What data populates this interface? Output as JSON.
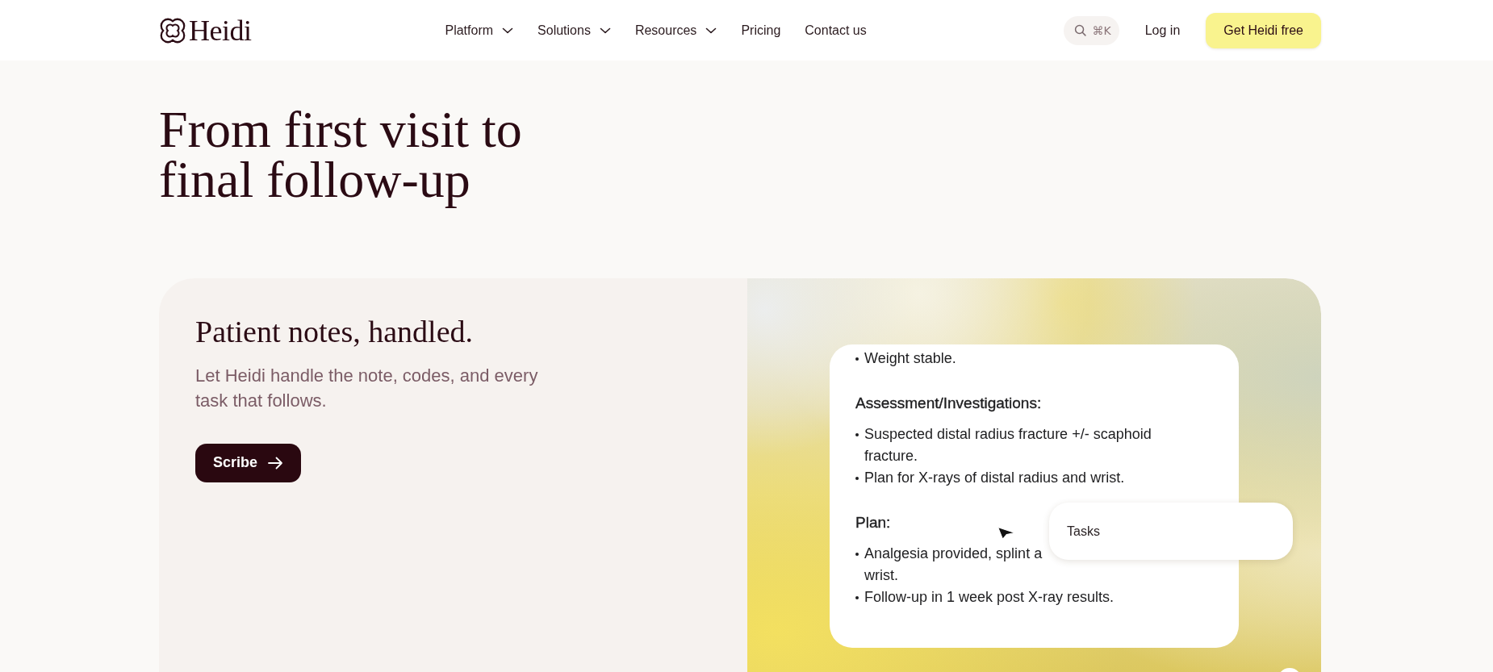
{
  "header": {
    "brand": "Heidi",
    "nav": [
      {
        "label": "Platform",
        "has_menu": true
      },
      {
        "label": "Solutions",
        "has_menu": true
      },
      {
        "label": "Resources",
        "has_menu": true
      },
      {
        "label": "Pricing",
        "has_menu": false
      },
      {
        "label": "Contact us",
        "has_menu": false
      }
    ],
    "search": {
      "shortcut": "⌘K"
    },
    "login": "Log in",
    "cta": "Get Heidi free"
  },
  "hero": {
    "title": "From first visit to final follow-up"
  },
  "feature_card": {
    "title": "Patient notes, handled.",
    "description": "Let Heidi handle the note, codes, and every task that follows.",
    "button": "Scribe",
    "note": {
      "sections": [
        {
          "items": [
            {
              "text": "Weight stable."
            }
          ]
        },
        {
          "heading": "Assessment/Investigations:",
          "items": [
            {
              "text": "Suspected distal radius fracture +/- scaphoid fracture."
            },
            {
              "text": "Plan for X-rays of distal radius and wrist."
            }
          ]
        },
        {
          "heading": "Plan:",
          "items": [
            {
              "lines": [
                "Analgesia provided, splint a",
                "wrist."
              ]
            },
            {
              "text": "Follow-up in 1 week post X-ray results."
            }
          ]
        }
      ]
    },
    "popup": {
      "label": "Tasks"
    }
  }
}
